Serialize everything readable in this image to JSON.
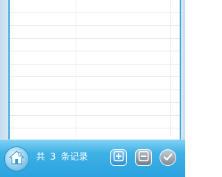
{
  "footer": {
    "record_prefix": "共",
    "record_count": "3",
    "record_suffix": "条记录"
  },
  "icons": {
    "home": "home-icon",
    "add": "plus-square-icon",
    "remove": "minus-square-icon",
    "confirm": "check-icon"
  },
  "colors": {
    "toolbar": "#2aa3de",
    "frame_border": "#3aa6da"
  }
}
